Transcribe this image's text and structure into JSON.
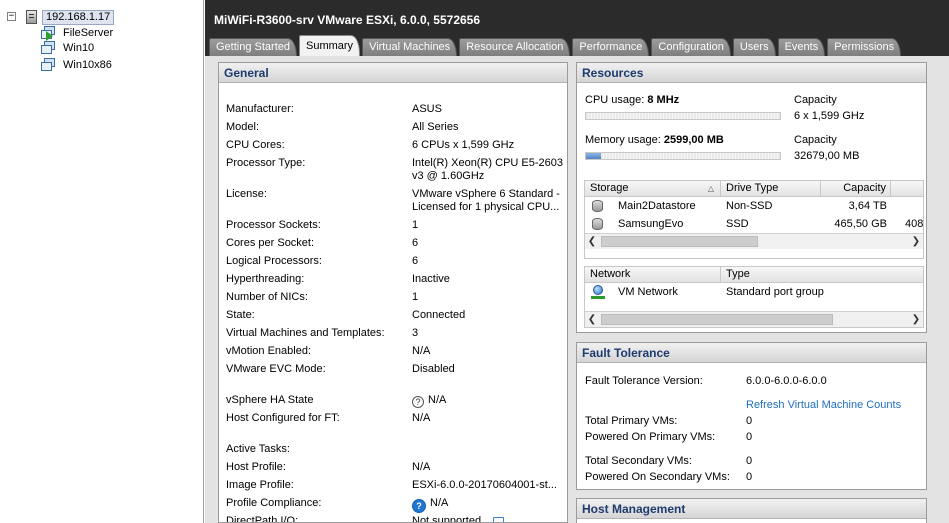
{
  "tree": {
    "host": "192.168.1.17",
    "expander": "−",
    "vms": [
      "FileServer",
      "Win10",
      "Win10x86"
    ]
  },
  "header": {
    "title": "MiWiFi-R3600-srv VMware ESXi, 6.0.0, 5572656"
  },
  "tabs": [
    "Getting Started",
    "Summary",
    "Virtual Machines",
    "Resource Allocation",
    "Performance",
    "Configuration",
    "Users",
    "Events",
    "Permissions"
  ],
  "active_tab": "Summary",
  "general": {
    "title": "General",
    "rows": [
      {
        "k": "Manufacturer:",
        "v": "ASUS"
      },
      {
        "k": "Model:",
        "v": "All Series"
      },
      {
        "k": "CPU Cores:",
        "v": "6 CPUs x 1,599 GHz"
      },
      {
        "k": "Processor Type:",
        "v": "Intel(R) Xeon(R) CPU E5-2603",
        "v2": "v3 @ 1.60GHz"
      },
      {
        "k": "License:",
        "v": "VMware vSphere 6 Standard -",
        "v2": "Licensed for 1 physical CPU..."
      },
      {
        "k": "Processor Sockets:",
        "v": "1"
      },
      {
        "k": "Cores per Socket:",
        "v": "6"
      },
      {
        "k": "Logical Processors:",
        "v": "6"
      },
      {
        "k": "Hyperthreading:",
        "v": "Inactive"
      },
      {
        "k": "Number of NICs:",
        "v": "1"
      },
      {
        "k": "State:",
        "v": "Connected"
      },
      {
        "k": "Virtual Machines and Templates:",
        "v": "3"
      },
      {
        "k": "vMotion Enabled:",
        "v": "N/A"
      },
      {
        "k": "VMware EVC Mode:",
        "v": "Disabled"
      },
      {
        "k": "vSphere HA State",
        "v": "N/A",
        "icon": "help"
      },
      {
        "k": "Host Configured for FT:",
        "v": "N/A"
      },
      {
        "k": "Active Tasks:",
        "v": ""
      },
      {
        "k": "Host Profile:",
        "v": "N/A"
      },
      {
        "k": "Image Profile:",
        "v": "ESXi-6.0.0-20170604001-st..."
      },
      {
        "k": "Profile Compliance:",
        "v": "N/A",
        "icon": "help-blue"
      },
      {
        "k": "DirectPath I/O:",
        "v": "Not supported",
        "icon_after": "bubble"
      }
    ]
  },
  "resources": {
    "title": "Resources",
    "cpu_label": "CPU usage:",
    "cpu_value": "8 MHz",
    "cpu_fraction": 0.001,
    "cpu_capacity_label": "Capacity",
    "cpu_capacity": "6 x 1,599 GHz",
    "mem_label": "Memory usage:",
    "mem_value": "2599,00 MB",
    "mem_fraction": 0.0795,
    "mem_capacity_label": "Capacity",
    "mem_capacity": "32679,00 MB",
    "storage": {
      "headers": [
        "Storage",
        "Drive Type",
        "Capacity"
      ],
      "rows": [
        {
          "name": "Main2Datastore",
          "type": "Non-SSD",
          "capacity": "3,64 TB",
          "extra": ""
        },
        {
          "name": "SamsungEvo",
          "type": "SSD",
          "capacity": "465,50 GB",
          "extra": "408"
        }
      ]
    },
    "network": {
      "headers": [
        "Network",
        "Type"
      ],
      "rows": [
        {
          "name": "VM Network",
          "type": "Standard port group"
        }
      ]
    }
  },
  "fault_tolerance": {
    "title": "Fault Tolerance",
    "version_label": "Fault Tolerance Version:",
    "version": "6.0.0-6.0.0-6.0.0",
    "refresh_link": "Refresh Virtual Machine Counts",
    "total_primary_label": "Total Primary VMs:",
    "total_primary": "0",
    "powered_primary_label": "Powered On Primary VMs:",
    "powered_primary": "0",
    "total_secondary_label": "Total Secondary VMs:",
    "total_secondary": "0",
    "powered_secondary_label": "Powered On Secondary VMs:",
    "powered_secondary": "0"
  },
  "host_management": {
    "title": "Host Management"
  }
}
